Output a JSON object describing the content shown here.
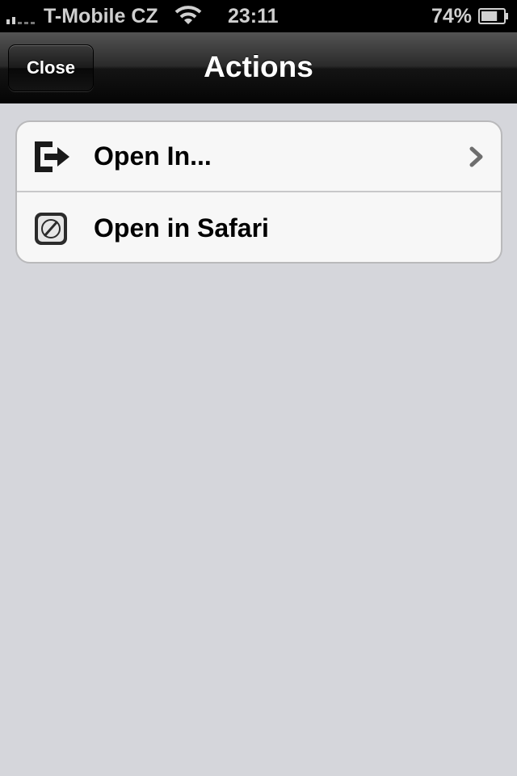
{
  "status_bar": {
    "carrier": "T-Mobile CZ",
    "time": "23:11",
    "battery_percent": "74%",
    "battery_level": 0.74,
    "signal_strength_bars": 2,
    "wifi_icon": "wifi-icon",
    "battery_icon": "battery-icon"
  },
  "nav_bar": {
    "title": "Actions",
    "close_label": "Close"
  },
  "actions": [
    {
      "label": "Open In...",
      "icon": "open-in-icon",
      "has_disclosure": true
    },
    {
      "label": "Open in Safari",
      "icon": "safari-compass-icon",
      "has_disclosure": false
    }
  ]
}
